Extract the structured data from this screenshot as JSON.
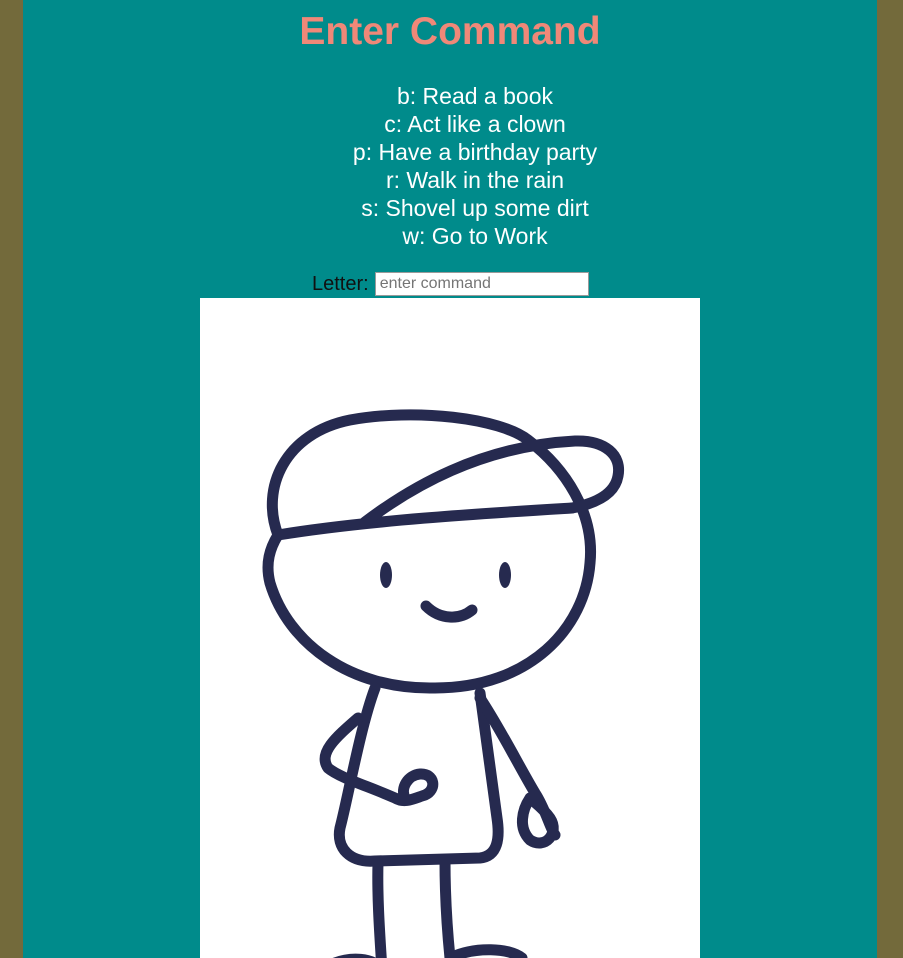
{
  "page": {
    "title": "Enter Command"
  },
  "commands": [
    {
      "text": "b: Read a book"
    },
    {
      "text": "c: Act like a clown"
    },
    {
      "text": "p: Have a birthday party"
    },
    {
      "text": "r: Walk in the rain"
    },
    {
      "text": "s: Shovel up some dirt"
    },
    {
      "text": "w: Go to Work"
    }
  ],
  "input": {
    "label": "Letter:",
    "placeholder": "enter command",
    "value": ""
  },
  "illustration": {
    "subject": "cartoon-boy-with-cap",
    "stroke_color": "#262a4f"
  },
  "colors": {
    "outer_bg": "#736a3b",
    "panel_bg": "#008b8b",
    "title": "#f08878",
    "command_text": "#ffffff"
  }
}
